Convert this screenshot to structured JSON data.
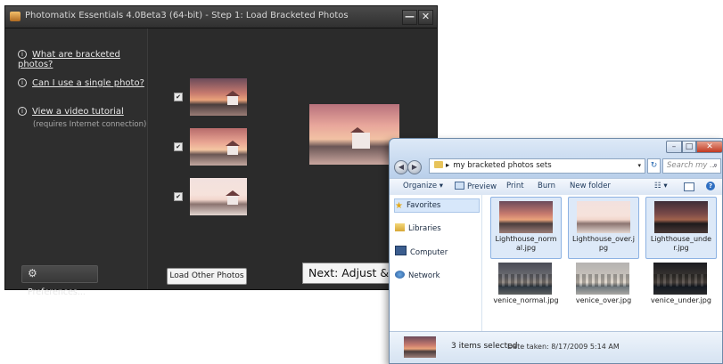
{
  "photomatix": {
    "title": "Photomatix Essentials  4.0Beta3 (64-bit) - Step 1: Load Bracketed Photos",
    "min_label": "—",
    "close_label": "✕",
    "help_links": [
      {
        "label": "What are bracketed photos?"
      },
      {
        "label": "Can I use a single photo?"
      },
      {
        "label": "View a video tutorial",
        "sub": "(requires Internet connection)"
      }
    ],
    "preferences_label": "Preferences...",
    "load_other_label": "Load Other Photos",
    "next_label": "Next: Adjust & Pr",
    "photos": [
      {
        "checked": true
      },
      {
        "checked": true
      },
      {
        "checked": true
      }
    ]
  },
  "explorer": {
    "title_buttons": {
      "min": "–",
      "max": "□",
      "close": "✕"
    },
    "address": {
      "separator": "▸",
      "path": "my bracketed photos sets",
      "dropdown": "▾"
    },
    "refresh": "↻",
    "search_placeholder": "Search my ...",
    "toolbar": {
      "organize": "Organize ▾",
      "preview": "Preview",
      "print": "Print",
      "burn": "Burn",
      "new_folder": "New folder",
      "views": "☷ ▾",
      "help": "?"
    },
    "nav": {
      "favorites": "Favorites",
      "libraries": "Libraries",
      "computer": "Computer",
      "network": "Network"
    },
    "files": [
      {
        "name": "Lighthouse_normal.jpg",
        "selected": true
      },
      {
        "name": "Lighthouse_over.jpg",
        "selected": true
      },
      {
        "name": "Lighthouse_under.jpg",
        "selected": true
      },
      {
        "name": "venice_normal.jpg",
        "selected": false
      },
      {
        "name": "venice_over.jpg",
        "selected": false
      },
      {
        "name": "venice_under.jpg",
        "selected": false
      }
    ],
    "status": {
      "count": "3 items selected",
      "date": "Date taken: 8/17/2009 5:14 AM"
    }
  }
}
